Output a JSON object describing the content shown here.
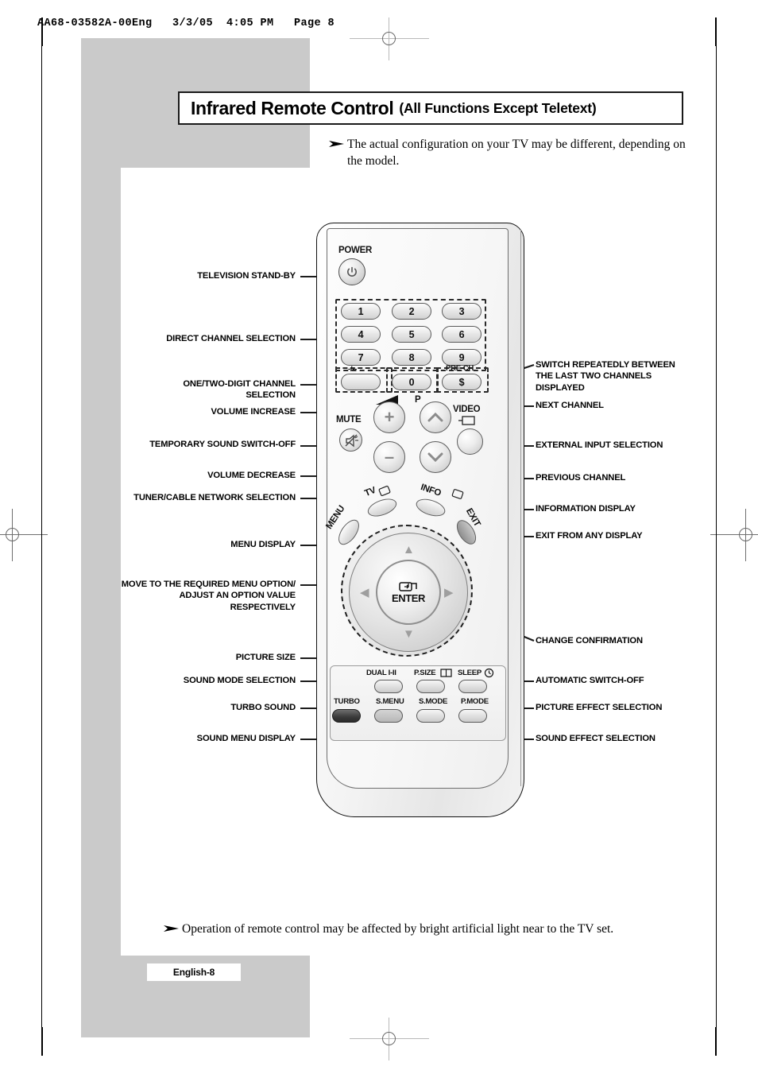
{
  "document": {
    "header": "AA68-03582A-00Eng   3/3/05  4:05 PM   Page 8",
    "page_tag": "English-8"
  },
  "title": {
    "main": "Infrared Remote Control",
    "sub": "(All Functions Except Teletext)"
  },
  "notes": {
    "top": "The actual configuration on your TV may be different, depending on the model.",
    "bottom": "Operation of remote control may be affected by bright artificial light near to the TV set."
  },
  "labels_left": [
    {
      "id": "television-stand-by",
      "text": "TELEVISION STAND-BY"
    },
    {
      "id": "direct-channel-selection",
      "text": "DIRECT CHANNEL SELECTION"
    },
    {
      "id": "one-two-digit-channel-selection",
      "text": "ONE/TWO-DIGIT CHANNEL SELECTION"
    },
    {
      "id": "volume-increase",
      "text": "VOLUME INCREASE"
    },
    {
      "id": "temporary-sound-switch-off",
      "text": "TEMPORARY SOUND SWITCH-OFF"
    },
    {
      "id": "volume-decrease",
      "text": "VOLUME DECREASE"
    },
    {
      "id": "tuner-cable-network-selection",
      "text": "TUNER/CABLE NETWORK SELECTION"
    },
    {
      "id": "menu-display",
      "text": "MENU DISPLAY"
    },
    {
      "id": "move-to-required-menu-option",
      "text": "MOVE TO THE REQUIRED MENU OPTION/ ADJUST AN OPTION VALUE RESPECTIVELY"
    },
    {
      "id": "picture-size",
      "text": "PICTURE SIZE"
    },
    {
      "id": "sound-mode-selection",
      "text": "SOUND MODE SELECTION"
    },
    {
      "id": "turbo-sound",
      "text": "TURBO SOUND"
    },
    {
      "id": "sound-menu-display",
      "text": "SOUND MENU DISPLAY"
    }
  ],
  "labels_right": [
    {
      "id": "switch-repeatedly-last-two-channels",
      "text": "SWITCH REPEATEDLY BETWEEN THE LAST TWO CHANNELS DISPLAYED"
    },
    {
      "id": "next-channel",
      "text": "NEXT CHANNEL"
    },
    {
      "id": "external-input-selection",
      "text": "EXTERNAL INPUT SELECTION"
    },
    {
      "id": "previous-channel",
      "text": "PREVIOUS CHANNEL"
    },
    {
      "id": "information-display",
      "text": "INFORMATION DISPLAY"
    },
    {
      "id": "exit-from-any-display",
      "text": "EXIT FROM ANY DISPLAY"
    },
    {
      "id": "change-confirmation",
      "text": "CHANGE CONFIRMATION"
    },
    {
      "id": "automatic-switch-off",
      "text": "AUTOMATIC SWITCH-OFF"
    },
    {
      "id": "picture-effect-selection",
      "text": "PICTURE EFFECT SELECTION"
    },
    {
      "id": "sound-effect-selection",
      "text": "SOUND EFFECT SELECTION"
    }
  ],
  "remote": {
    "power_label": "POWER",
    "numbers": [
      "1",
      "2",
      "3",
      "4",
      "5",
      "6",
      "7",
      "8",
      "9"
    ],
    "dash_key": "-/--",
    "zero_key": "0",
    "prech_label": "PRE-CH",
    "prech_glyph": "$",
    "p_label": "P",
    "mute_label": "MUTE",
    "video_label": "VIDEO",
    "tv_label": "TV",
    "info_label": "INFO",
    "menu_label": "MENU",
    "exit_label": "EXIT",
    "enter_label": "ENTER",
    "vol_up_glyph": "+",
    "vol_down_glyph": "–",
    "ch_up_glyph": "⌃",
    "ch_down_glyph": "⌄",
    "bottom_row_top": [
      "DUAL I-II",
      "P.SIZE",
      "SLEEP"
    ],
    "bottom_row_bottom": [
      "TURBO",
      "S.MENU",
      "S.MODE",
      "P.MODE"
    ]
  },
  "colors": {
    "gray_block": "#cacaca",
    "ink": "#000000",
    "leader": "#1c1c1c",
    "turbo_button": "#3a3a3a"
  }
}
